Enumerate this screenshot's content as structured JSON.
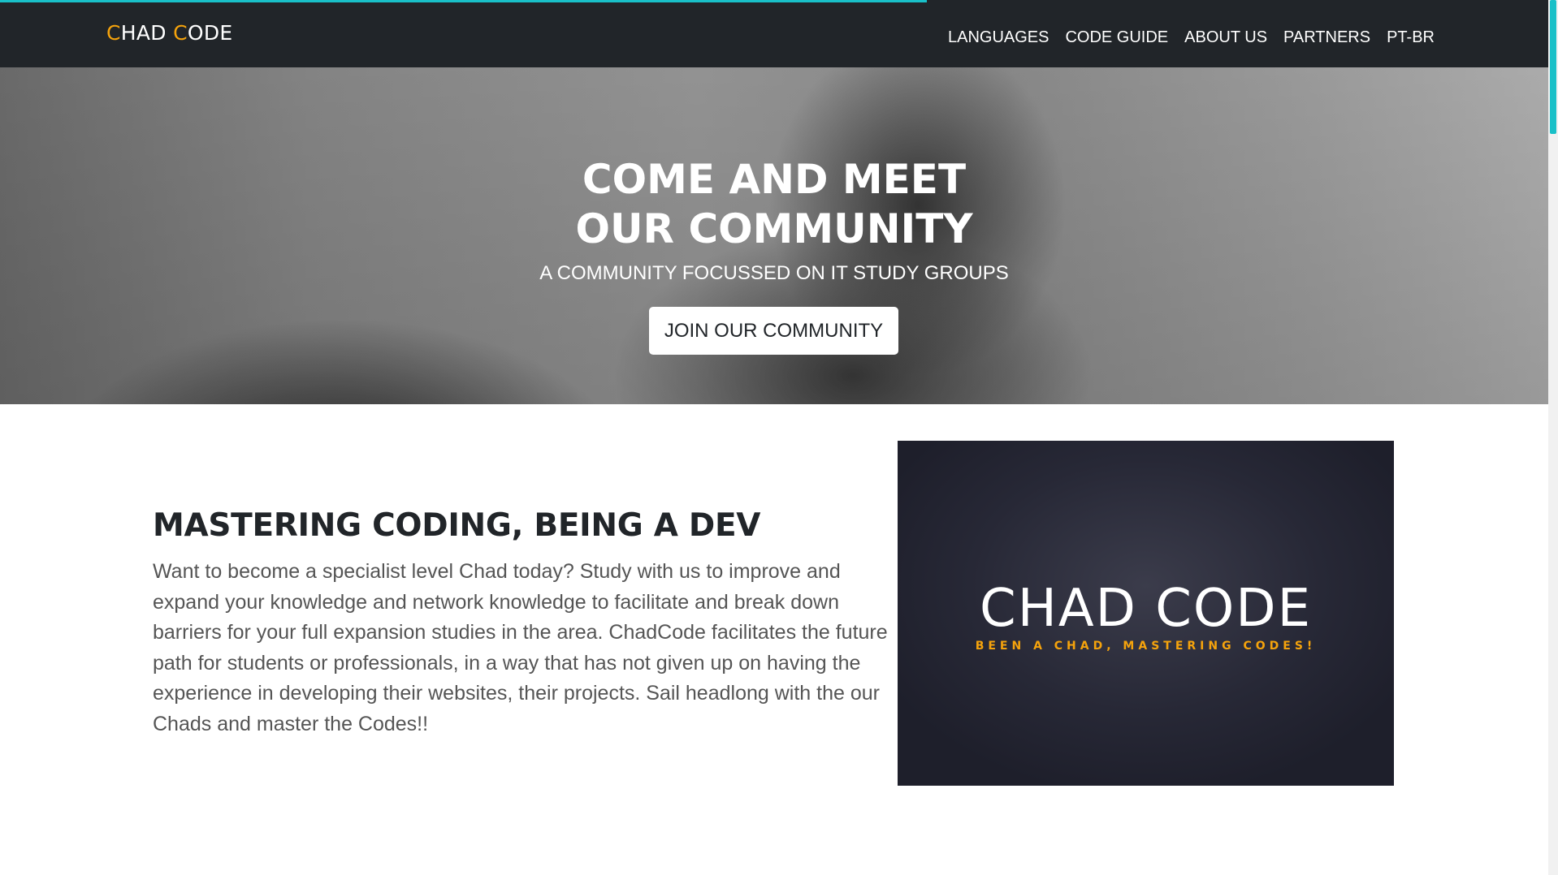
{
  "progress": {
    "fraction": 0.595,
    "color": "#19c0c8"
  },
  "navbar": {
    "brand": {
      "first_initial": "C",
      "first_rest": "HAD ",
      "second_initial": "C",
      "second_rest": "ODE"
    },
    "links": [
      "LANGUAGES",
      "CODE GUIDE",
      "ABOUT US",
      "PARTNERS",
      "PT-BR"
    ],
    "accent_color": "#f5a30c",
    "background": "#212529"
  },
  "hero": {
    "title_line1": "COME AND MEET",
    "title_line2": "OUR COMMUNITY",
    "subtitle": "A COMMUNITY FOCUSSED ON IT STUDY GROUPS",
    "button_label": "JOIN OUR COMMUNITY"
  },
  "main": {
    "heading": "MASTERING CODING, BEING A DEV",
    "body": "Want to become a specialist level Chad today? Study with us to improve and expand your knowledge and network knowledge to facilitate and break down barriers for your full expansion studies in the area. ChadCode facilitates the future path for students or professionals, in a way that has not given up on having the experience in developing their websites, their projects. Sail headlong with the our Chads and master the Codes!!",
    "logo_image": {
      "title": "CHAD CODE",
      "tagline": "BEEN A CHAD, MASTERING CODES!"
    }
  }
}
